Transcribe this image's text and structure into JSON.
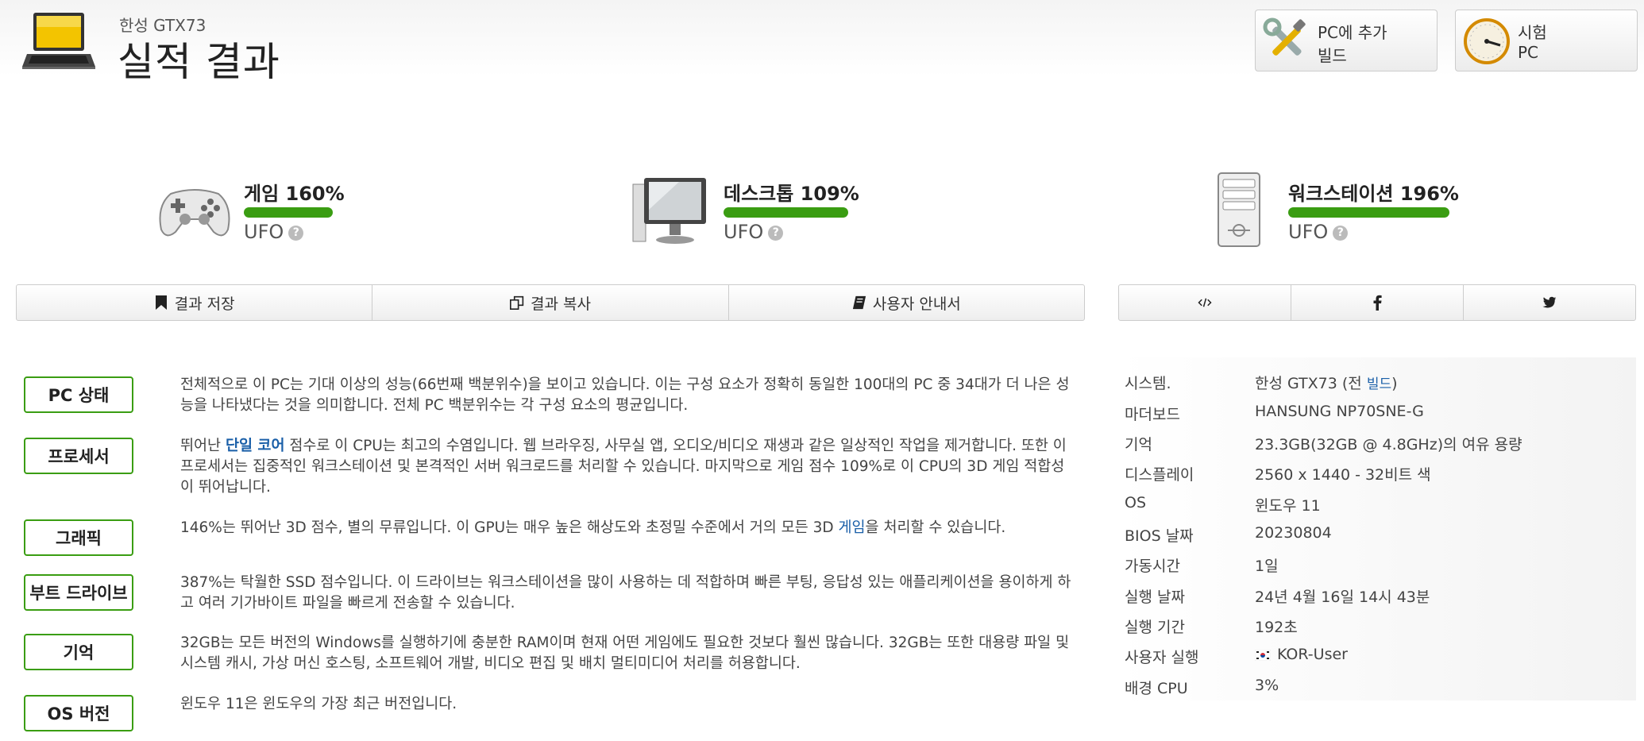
{
  "header": {
    "subtitle": "한성 GTX73",
    "title": "실적 결과",
    "buttons": [
      {
        "line1": "PC에 추가",
        "line2": "빌드",
        "icon": "tools-icon"
      },
      {
        "line1": "시험",
        "line2": "PC",
        "icon": "gauge-icon"
      }
    ]
  },
  "scores": [
    {
      "label": "게임 160%",
      "rating": "UFO",
      "icon": "gamepad-icon",
      "percent": 160
    },
    {
      "label": "데스크톱 109%",
      "rating": "UFO",
      "icon": "desktop-icon",
      "percent": 109
    },
    {
      "label": "워크스테이션 196%",
      "rating": "UFO",
      "icon": "workstation-icon",
      "percent": 196
    }
  ],
  "actions": {
    "save": "결과 저장",
    "copy": "결과 복사",
    "guide": "사용자 안내서"
  },
  "share": {
    "embed": "embed-icon",
    "facebook": "facebook-icon",
    "twitter": "twitter-icon"
  },
  "status": [
    {
      "label": "PC 상태",
      "text": "전체적으로 이 PC는 기대 이상의 성능(66번째 백분위수)을 보이고 있습니다. 이는 구성 요소가 정확히 동일한 100대의 PC 중 34대가 더 나은 성능을 나타냈다는 것을 의미합니다. 전체 PC 백분위수는 각 구성 요소의 평균입니다."
    },
    {
      "label": "프로세서",
      "text_pre": "뛰어난 ",
      "highlight": "단일 코어",
      "text_post": " 점수로 이 CPU는 최고의 수염입니다. 웹 브라우징, 사무실 앱, 오디오/비디오 재생과 같은 일상적인 작업을 제거합니다. 또한 이 프로세서는 집중적인 워크스테이션 및 본격적인 서버 워크로드를 처리할 수 있습니다. 마지막으로 게임 점수 109%로 이 CPU의 3D 게임 적합성이 뛰어납니다."
    },
    {
      "label": "그래픽",
      "text_pre": "146%는 뛰어난 3D 점수, 별의 무류입니다. 이 GPU는 매우 높은 해상도와 초정밀 수준에서 거의 모든 3D ",
      "link": "게임",
      "text_post": "을 처리할 수 있습니다."
    },
    {
      "label": "부트 드라이브",
      "text": "387%는 탁월한 SSD 점수입니다. 이 드라이브는 워크스테이션을 많이 사용하는 데 적합하며 빠른 부팅, 응답성 있는 애플리케이션을 용이하게 하고 여러 기가바이트 파일을 빠르게 전송할 수 있습니다."
    },
    {
      "label": "기억",
      "text": "32GB는 모든 버전의 Windows를 실행하기에 충분한 RAM이며 현재 어떤 게임에도 필요한 것보다 훨씬 많습니다. 32GB는 또한 대용량 파일 및 시스템 캐시, 가상 머신 호스팅, 소프트웨어 개발, 비디오 편집 및 배치 멀티미디어 처리를 허용합니다."
    },
    {
      "label": "OS 버전",
      "text": "윈도우 11은 윈도우의 가장 최근 버전입니다."
    }
  ],
  "specs": [
    {
      "key": "시스템.",
      "value": "한성 GTX73 (전 ",
      "link": "빌드",
      "suffix": ")"
    },
    {
      "key": "마더보드",
      "value": "HANSUNG NP70SNE-G"
    },
    {
      "key": "기억",
      "value": "23.3GB(32GB @ 4.8GHz)의 여유 용량"
    },
    {
      "key": "디스플레이",
      "value": "2560 x 1440 - 32비트 색"
    },
    {
      "key": "OS",
      "value": "윈도우 11"
    },
    {
      "key": "BIOS 날짜",
      "value": "20230804"
    },
    {
      "key": "가동시간",
      "value": "1일"
    },
    {
      "key": "실행 날짜",
      "value": "24년 4월 16일 14시 43분"
    },
    {
      "key": "실행 기간",
      "value": "192초"
    },
    {
      "key": "사용자 실행",
      "value": "KOR-User",
      "icon": "korea-flag-icon"
    },
    {
      "key": "배경 CPU",
      "value": "3%"
    }
  ],
  "colors": {
    "accent_green": "#3a9d12",
    "link_blue": "#1a5fa8"
  }
}
